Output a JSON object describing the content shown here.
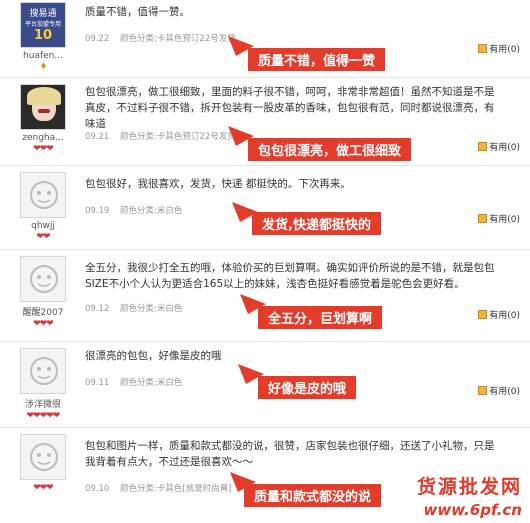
{
  "reviews": [
    {
      "username": "huafen...",
      "badge_text": "搜易通",
      "badge_sub": "平台加盟专用",
      "badge_num": "10",
      "hearts": "♦",
      "text": "质量不错，值得一赞。",
      "date": "09.22",
      "spec": "颜色分类:卡其色预订22号发货",
      "useful": "有用(0)",
      "note": "质量不错，值得一赞"
    },
    {
      "username": "zengha...",
      "hearts": "❤❤❤",
      "text": "包包很漂亮，做工很细致，里面的料子很不错，呵呵，非常非常超值！虽然不知道是不是真皮，不过料子很不错，拆开包装有一股皮革的香味，包包很有范，同时都说很漂亮，有味道",
      "date": "09.21",
      "spec": "颜色分类:卡其色预订22号发货",
      "useful": "有用(0)",
      "note": "包包很漂亮，做工很细致"
    },
    {
      "username": "qhwjj",
      "hearts": "❤❤",
      "text": "包包很好，我很喜欢，发货，快递 都挺快的。下次再来。",
      "date": "09.19",
      "spec": "颜色分类:米白色",
      "useful": "有用(0)",
      "note": "发货,快递都挺快的"
    },
    {
      "username": "醒醒2007",
      "hearts": "❤❤❤",
      "text": "全五分，我很少打全五的哦，体验价买的巨划算啊。确实如评价所说的是不错，就是包包SIZE不小个人认为更适合165以上的妹妹，浅杏色挺好看感觉着是驼色会更好看。",
      "date": "09.12",
      "spec": "颜色分类:米白色",
      "useful": "有用(0)",
      "note": "全五分，巨划算啊"
    },
    {
      "username": "涉洋微很",
      "hearts": "❤❤❤❤❤",
      "text": "很漂亮的包包，好像是皮的哦",
      "date": "09.11",
      "spec": "颜色分类:米白色",
      "useful": "有用(0)",
      "note": "好像是皮的哦"
    },
    {
      "username": "",
      "hearts": "❤❤❤",
      "text": "包包和图片一样，质量和款式都没的说，很赞，店家包装也很仔细，还送了小礼物，只是我背着有点大，不过还是很喜欢～～",
      "date": "09.10",
      "spec": "颜色分类:卡其色[就是时尚黄]",
      "useful": "有用(0)",
      "note": "质量和款式都没的说"
    }
  ],
  "watermark": {
    "line1": "货源批发网",
    "line2": "www.6pf.cn"
  },
  "colors": {
    "note_bg": "#e43c2b",
    "heart": "#d63a3a"
  },
  "icons": {
    "useful": "useful-icon",
    "avatar_default": "default-avatar-icon"
  }
}
